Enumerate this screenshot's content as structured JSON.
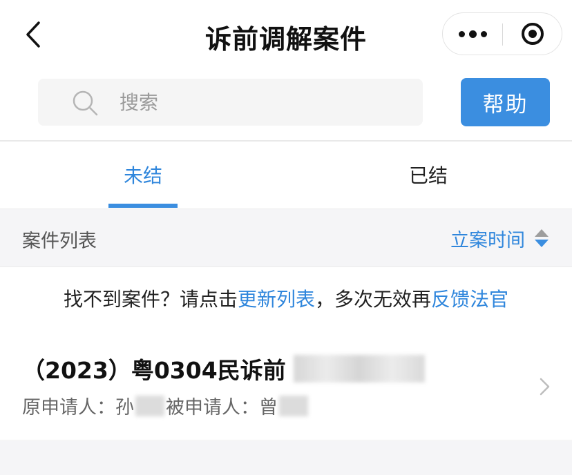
{
  "nav": {
    "title": "诉前调解案件"
  },
  "search": {
    "placeholder": "搜索"
  },
  "help_label": "帮助",
  "tabs": [
    {
      "label": "未结",
      "active": true
    },
    {
      "label": "已结",
      "active": false
    }
  ],
  "list_header": {
    "title": "案件列表",
    "sort_label": "立案时间"
  },
  "notice": {
    "prefix": "找不到案件？请点击",
    "link1": "更新列表",
    "middle": "，多次无效再",
    "link2": "反馈法官"
  },
  "cases": [
    {
      "number": "（2023）粤0304民诉前",
      "applicant_label": "原申请人：",
      "applicant": "孙",
      "respondent_label": "被申请人：",
      "respondent": "曾"
    }
  ],
  "colors": {
    "accent": "#3b8ee0",
    "link": "#2f86dc",
    "header_bg": "#f5f5f7"
  },
  "icons": [
    "back-arrow-icon",
    "more-dots-icon",
    "close-target-icon",
    "search-icon",
    "sort-arrows-icon",
    "chevron-right-icon"
  ]
}
